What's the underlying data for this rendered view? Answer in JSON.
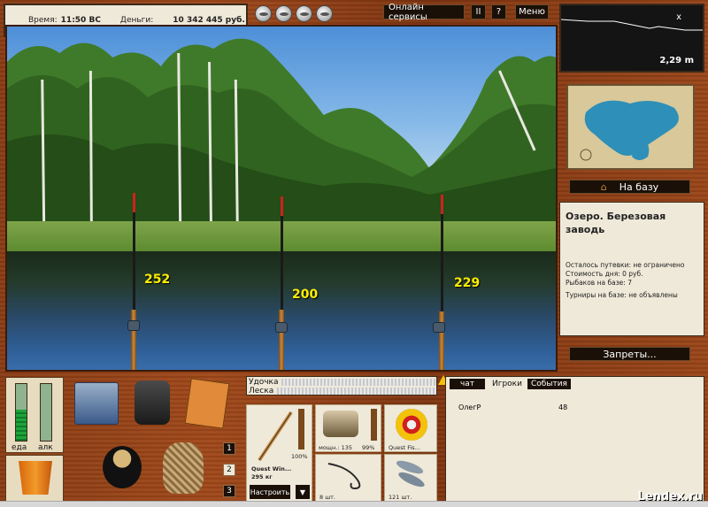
{
  "status": {
    "time_label": "Время:",
    "time_value": "11:50 ВС",
    "money_label": "Деньги:",
    "money_value": "10 342 445 руб."
  },
  "top_buttons": {
    "online": "Онлайн сервисы",
    "pause": "II",
    "help": "?",
    "menu": "Меню"
  },
  "depth_map": {
    "close": "x",
    "depth_value": "2,29 m"
  },
  "buttons": {
    "to_base": "На базу",
    "bans": "Запреты..."
  },
  "location": {
    "title": "Озеро. Березовая заводь",
    "lines": [
      "Осталось путевки: не ограничено",
      "Стоимость дня: 0 руб.",
      "Рыбаков на базе: 7",
      "",
      "Турниры на базе: не объявлены"
    ]
  },
  "scene": {
    "depths": [
      "252",
      "200",
      "229"
    ]
  },
  "meters": {
    "food_label": "еда",
    "alcohol_label": "алк",
    "food_level": 0.55,
    "alcohol_level": 0.0
  },
  "inventory_pages": [
    "1",
    "2",
    "3"
  ],
  "tackle": {
    "rod_label": "Удочка",
    "line_label": "Леска",
    "rod_name": "Quest Win...",
    "rod_weight": "295 кг",
    "rod_condition": "100%",
    "reel_power_label": "мощн.: 135",
    "reel_condition": "99%",
    "line_name": "Quest Fis...",
    "hook_count": "8 шт.",
    "bait_count": "121 шт.",
    "setup_button": "Настроить",
    "dropdown_button": "▼"
  },
  "chat": {
    "tabs": [
      "чат",
      "Игроки",
      "События"
    ],
    "active_tab": 1,
    "players": [
      {
        "name": "ОлегР",
        "value": "48"
      }
    ]
  },
  "watermark": "Lendex.ru"
}
